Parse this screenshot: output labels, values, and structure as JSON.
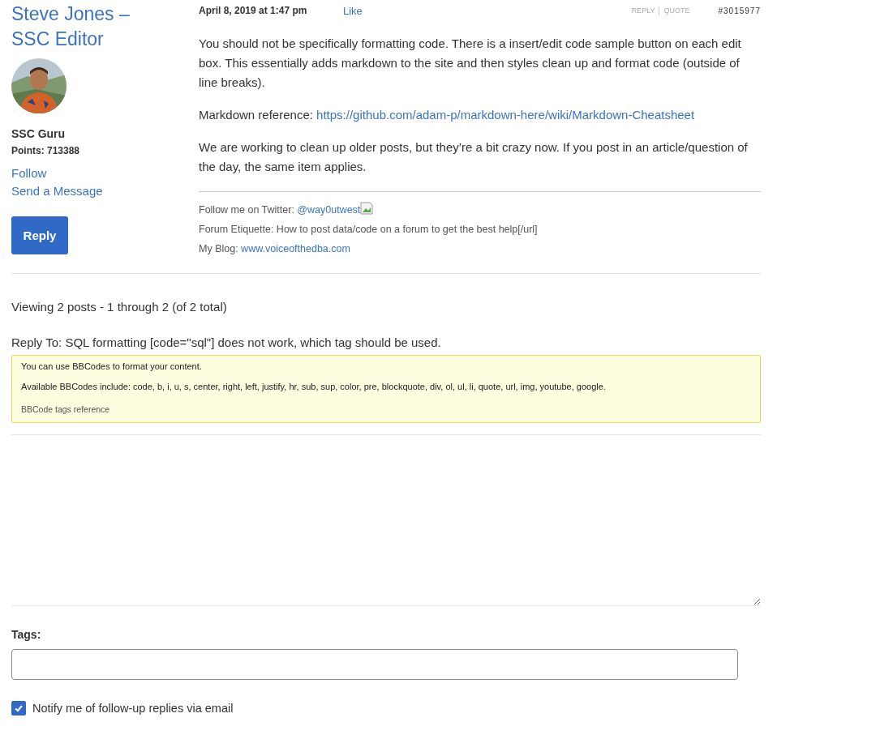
{
  "author": {
    "name": "Steve Jones – SSC Editor",
    "avatar": {
      "kind": "picture"
    },
    "rank": "SSC Guru",
    "points": "Points: 713388",
    "links": [
      "Follow",
      "Send a Message"
    ],
    "reply_button": "Reply"
  },
  "post": {
    "date": "April 8, 2019 at 1:47 pm",
    "like": "Like",
    "actions": [
      "REPLY",
      "QUOTE"
    ],
    "id": "#3015977",
    "paragraphs": [
      {
        "text": "You should not be specifically formatting code. There is a insert/edit code sample button on each edit box. This essentially adds markdown to the site and then styles clean up and format code (outside of line breaks)."
      },
      {
        "text": "Markdown reference: ",
        "link": "https://github.com/adam-p/markdown-here/wiki/Markdown-Cheatsheet"
      },
      {
        "text": "We are working to clean up older posts, but they’re a bit crazy now. If you post in an article/question of the day, the same item applies."
      }
    ],
    "signature": [
      {
        "text": "Follow me on Twitter: ",
        "link": "@way0utwest",
        "broken_image": true
      },
      {
        "text": "Forum Etiquette: How to post data/code on a forum to get the best help[/url]"
      },
      {
        "text": "My Blog: ",
        "link": "www.voiceofthedba.com"
      }
    ]
  },
  "viewing": "Viewing 2 posts - 1 through 2 (of 2 total)",
  "reply_form": {
    "title": "Reply To: SQL formatting [code=\"sql\"] does not work, which tag should be used.",
    "notice": {
      "lines": [
        "You can use BBCodes to format your content.",
        "Available BBCodes include: code, b, i, u, s, center, right, left, justify, hr, sub, sup, color, pre, blockquote, div, ol, ul, li, quote, url, img, youtube, google."
      ],
      "link": "BBCode tags reference"
    },
    "tags_label": "Tags:",
    "notify": {
      "label": "Notify me of follow-up replies via email",
      "checked": true
    }
  }
}
